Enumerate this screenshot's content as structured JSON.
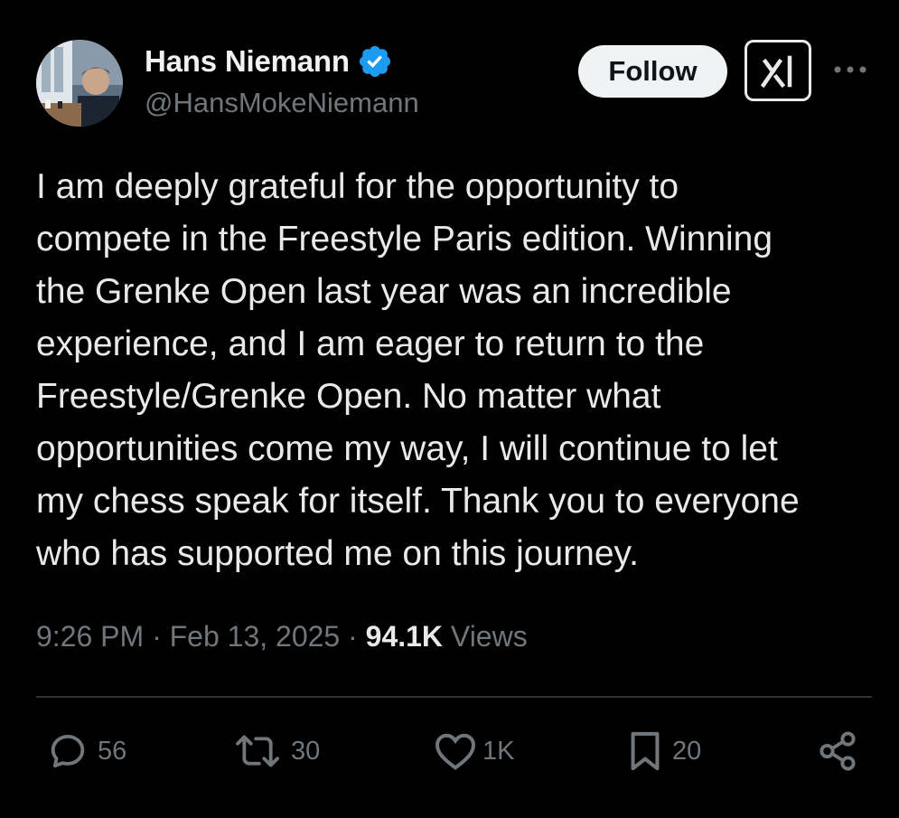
{
  "author": {
    "name": "Hans Niemann",
    "handle": "@HansMokeNiemann",
    "verified": true,
    "verified_color": "#1d9bf0"
  },
  "header": {
    "follow_label": "Follow",
    "grok_icon": "grok-icon",
    "more_icon": "more-icon"
  },
  "tweet": {
    "lines": [
      "I am deeply grateful for the opportunity to",
      "compete in the Freestyle Paris edition. Winning",
      "the Grenke Open last year was an incredible",
      "experience, and I am eager to return to the",
      "Freestyle/Grenke Open. No matter what",
      "opportunities come my way, I will continue to let",
      "my chess speak for itself. Thank you to everyone",
      "who has supported me on this journey."
    ],
    "time": "9:26 PM",
    "separator": "·",
    "date": "Feb 13, 2025",
    "views_count": "94.1K",
    "views_label": "Views"
  },
  "actions": {
    "replies": "56",
    "reposts": "30",
    "likes": "1K",
    "bookmarks": "20"
  },
  "colors": {
    "background": "#000000",
    "text_primary": "#e7e9ea",
    "text_secondary": "#71767b",
    "divider": "#2f3336",
    "follow_bg": "#eff3f4"
  }
}
